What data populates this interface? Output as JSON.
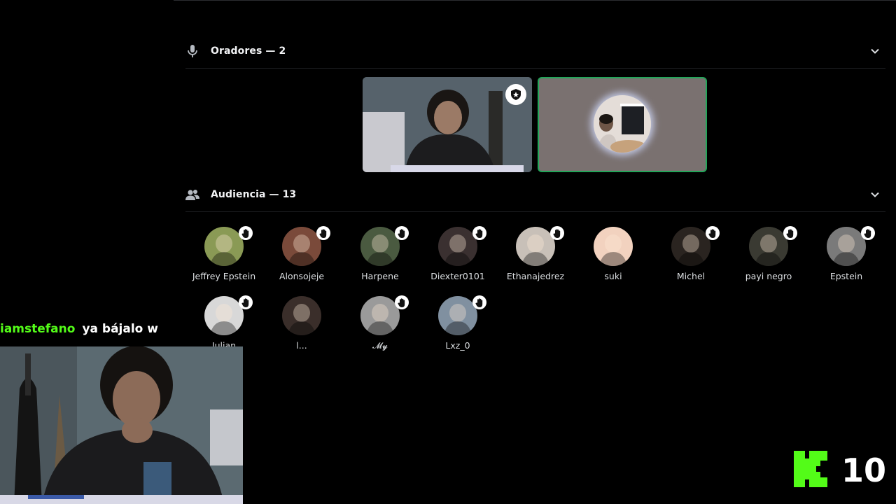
{
  "speakers": {
    "title": "Oradores — 2",
    "icon": "microphone-icon",
    "tiles": [
      {
        "type": "video",
        "badge": "moderator-badge-icon"
      },
      {
        "type": "avatar",
        "speaking": true
      }
    ]
  },
  "audience": {
    "title": "Audiencia — 13",
    "icon": "people-icon",
    "members": [
      {
        "name": "Jeffrey Epstein",
        "hand_raised": true,
        "color": "#8a9a55"
      },
      {
        "name": "Alonsojeje",
        "hand_raised": true,
        "color": "#7a4a3a"
      },
      {
        "name": "Harpene",
        "hand_raised": true,
        "color": "#4a5a40"
      },
      {
        "name": "Diexter0101",
        "hand_raised": true,
        "color": "#3a3030"
      },
      {
        "name": "Ethanajedrez",
        "hand_raised": true,
        "color": "#c8c0b8"
      },
      {
        "name": "suki",
        "hand_raised": false,
        "color": "#f2d2bf"
      },
      {
        "name": "Michel",
        "hand_raised": true,
        "color": "#2a2420"
      },
      {
        "name": "payi negro",
        "hand_raised": true,
        "color": "#3a3a32"
      },
      {
        "name": "Epstein",
        "hand_raised": true,
        "color": "#7a7a7a"
      },
      {
        "name": "Julian",
        "hand_raised": true,
        "color": "#d8d8d8"
      },
      {
        "name": "l...",
        "hand_raised": false,
        "color": "#3a2e2a"
      },
      {
        "name": "𝓜𝔂",
        "hand_raised": true,
        "color": "#9a9a9a"
      },
      {
        "name": "Lxz_0",
        "hand_raised": true,
        "color": "#8090a0"
      }
    ]
  },
  "chat": {
    "username": "iamstefano",
    "message": "ya bájalo w"
  },
  "overlay": {
    "logo": "kick-logo-icon",
    "count": "10"
  },
  "colors": {
    "speaking": "#23a559",
    "chat_username": "#53fc18",
    "kick_green": "#53fc18"
  }
}
